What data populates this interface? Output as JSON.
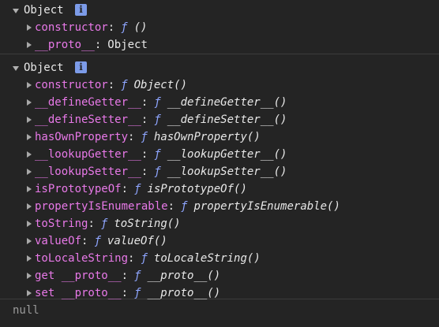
{
  "console": {
    "entry1": {
      "label": "Object",
      "info": "i",
      "props": [
        {
          "key": "constructor",
          "f": "ƒ",
          "value": "()"
        },
        {
          "key": "__proto__",
          "value": "Object"
        }
      ]
    },
    "entry2": {
      "label": "Object",
      "info": "i",
      "props": [
        {
          "key": "constructor",
          "f": "ƒ",
          "value": "Object()"
        },
        {
          "key": "__defineGetter__",
          "f": "ƒ",
          "value": "__defineGetter__()"
        },
        {
          "key": "__defineSetter__",
          "f": "ƒ",
          "value": "__defineSetter__()"
        },
        {
          "key": "hasOwnProperty",
          "f": "ƒ",
          "value": "hasOwnProperty()"
        },
        {
          "key": "__lookupGetter__",
          "f": "ƒ",
          "value": "__lookupGetter__()"
        },
        {
          "key": "__lookupSetter__",
          "f": "ƒ",
          "value": "__lookupSetter__()"
        },
        {
          "key": "isPrototypeOf",
          "f": "ƒ",
          "value": "isPrototypeOf()"
        },
        {
          "key": "propertyIsEnumerable",
          "f": "ƒ",
          "value": "propertyIsEnumerable()"
        },
        {
          "key": "toString",
          "f": "ƒ",
          "value": "toString()"
        },
        {
          "key": "valueOf",
          "f": "ƒ",
          "value": "valueOf()"
        },
        {
          "key": "toLocaleString",
          "f": "ƒ",
          "value": "toLocaleString()"
        },
        {
          "key": "get __proto__",
          "f": "ƒ",
          "value": "__proto__()"
        },
        {
          "key": "set __proto__",
          "f": "ƒ",
          "value": "__proto__()"
        }
      ]
    },
    "result": "null"
  },
  "colors": {
    "background": "#242424",
    "key": "#e879e8",
    "function_marker": "#8fa6ff",
    "info_badge": "#7c9be8",
    "result": "#9a9a9a",
    "separator": "#3c3c3c"
  },
  "icons": {
    "expand": "triangle-down-icon",
    "collapse": "triangle-right-icon",
    "info": "info-icon"
  }
}
